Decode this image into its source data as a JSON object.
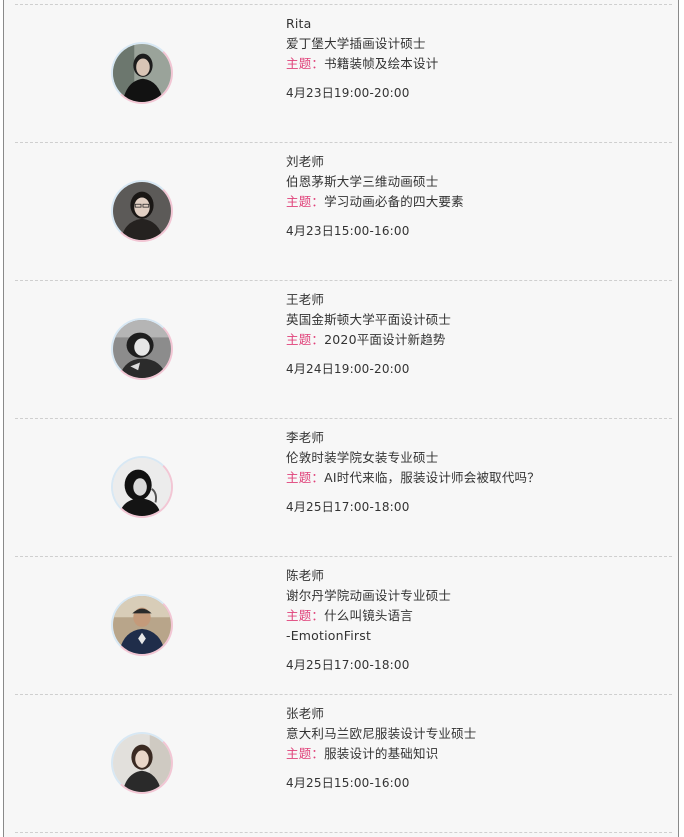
{
  "topic_label": "主题：",
  "teachers": [
    {
      "name": "Rita",
      "degree": "爱丁堡大学插画设计硕士",
      "topic": "书籍装帧及绘本设计",
      "topic_extra": "",
      "time": "4月23日19:00-20:00"
    },
    {
      "name": "刘老师",
      "degree": "伯恩茅斯大学三维动画硕士",
      "topic": "学习动画必备的四大要素",
      "topic_extra": "",
      "time": "4月23日15:00-16:00"
    },
    {
      "name": "王老师",
      "degree": "英国金斯顿大学平面设计硕士",
      "topic": "2020平面设计新趋势",
      "topic_extra": "",
      "time": "4月24日19:00-20:00"
    },
    {
      "name": "李老师",
      "degree": "伦敦时装学院女装专业硕士",
      "topic": "AI时代来临，服装设计师会被取代吗？",
      "topic_extra": "",
      "time": "4月25日17:00-18:00"
    },
    {
      "name": "陈老师",
      "degree": "谢尔丹学院动画设计专业硕士",
      "topic": "什么叫镜头语言",
      "topic_extra": "-EmotionFirst",
      "time": "4月25日17:00-18:00"
    },
    {
      "name": "张老师",
      "degree": "意大利马兰欧尼服装设计专业硕士",
      "topic": "服装设计的基础知识",
      "topic_extra": "",
      "time": "4月25日15:00-16:00"
    }
  ]
}
